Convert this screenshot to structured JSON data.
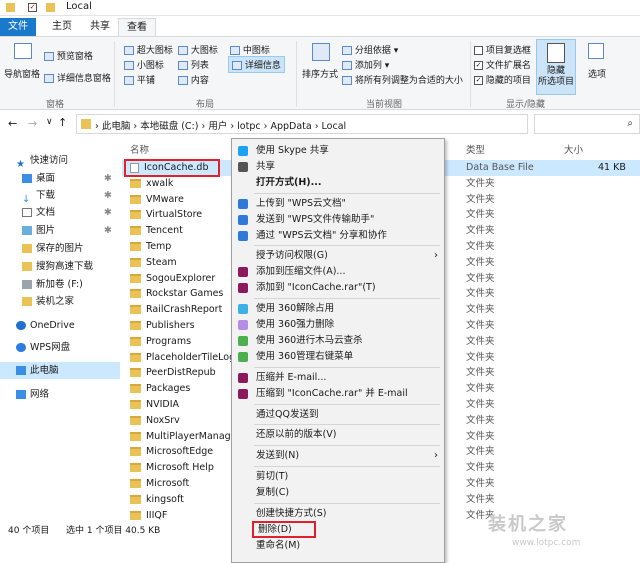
{
  "window": {
    "title": "Local"
  },
  "ribbon_tabs": [
    "文件",
    "主页",
    "共享",
    "查看"
  ],
  "ribbon": {
    "nav_pane": "导航窗格",
    "preview_pane": "预览窗格",
    "details_pane": "详细信息窗格",
    "pane_group": "窗格",
    "layout": {
      "items": [
        "超大图标",
        "大图标",
        "中图标",
        "小图标",
        "列表",
        "详细信息",
        "平铺",
        "内容"
      ],
      "group": "布局"
    },
    "sort_by": "排序方式",
    "group_by": "分组依据",
    "add_column": "添加列",
    "fit_columns": "将所有列调整为合适的大小",
    "current_view_group": "当前视图",
    "item_checkboxes": "项目复选框",
    "file_ext": "文件扩展名",
    "hidden_items": "隐藏的项目",
    "hide_selected": "隐藏\n所选项目",
    "show_hide_group": "显示/隐藏",
    "options": "选项"
  },
  "address": {
    "crumbs": [
      "此电脑",
      "本地磁盘 (C:)",
      "用户",
      "lotpc",
      "AppData",
      "Local"
    ]
  },
  "sidebar": {
    "items": [
      "快速访问",
      "桌面",
      "下载",
      "文档",
      "图片",
      "保存的图片",
      "搜狗高速下载",
      "新加卷 (F:)",
      "装机之家",
      "OneDrive",
      "WPS网盘",
      "此电脑",
      "网络"
    ]
  },
  "columns": {
    "name": "名称",
    "type": "类型",
    "size": "大小"
  },
  "files": [
    {
      "name": "IconCache.db",
      "type": "Data Base File",
      "size": "41 KB"
    },
    {
      "name": "xwalk",
      "type": "文件夹",
      "size": ""
    },
    {
      "name": "VMware",
      "type": "文件夹",
      "size": ""
    },
    {
      "name": "VirtualStore",
      "type": "文件夹",
      "size": ""
    },
    {
      "name": "Tencent",
      "type": "文件夹",
      "size": ""
    },
    {
      "name": "Temp",
      "type": "文件夹",
      "size": ""
    },
    {
      "name": "Steam",
      "type": "文件夹",
      "size": ""
    },
    {
      "name": "SogouExplorer",
      "type": "文件夹",
      "size": ""
    },
    {
      "name": "Rockstar Games",
      "type": "文件夹",
      "size": ""
    },
    {
      "name": "RailCrashReport",
      "type": "文件夹",
      "size": ""
    },
    {
      "name": "Publishers",
      "type": "文件夹",
      "size": ""
    },
    {
      "name": "Programs",
      "type": "文件夹",
      "size": ""
    },
    {
      "name": "PlaceholderTileLogo",
      "type": "文件夹",
      "size": ""
    },
    {
      "name": "PeerDistRepub",
      "type": "文件夹",
      "size": ""
    },
    {
      "name": "Packages",
      "type": "文件夹",
      "size": ""
    },
    {
      "name": "NVIDIA",
      "type": "文件夹",
      "size": ""
    },
    {
      "name": "NoxSrv",
      "type": "文件夹",
      "size": ""
    },
    {
      "name": "MultiPlayerManager",
      "type": "文件夹",
      "size": ""
    },
    {
      "name": "MicrosoftEdge",
      "type": "文件夹",
      "size": ""
    },
    {
      "name": "Microsoft Help",
      "type": "文件夹",
      "size": ""
    },
    {
      "name": "Microsoft",
      "type": "文件夹",
      "size": ""
    },
    {
      "name": "kingsoft",
      "type": "文件夹",
      "size": ""
    },
    {
      "name": "IIIQF",
      "type": "文件夹",
      "size": ""
    }
  ],
  "status": {
    "count": "40 个项目",
    "selected": "选中 1 个项目 40.5 KB"
  },
  "context_menu": [
    {
      "label": "使用 Skype 共享",
      "icon": "skype-icon",
      "color": "#1da1f2"
    },
    {
      "label": "共享",
      "icon": "share-icon",
      "color": "#555555"
    },
    {
      "label": "打开方式(H)...",
      "bold": true
    },
    {
      "sep": true
    },
    {
      "label": "上传到 \"WPS云文档\"",
      "icon": "upload-icon",
      "color": "#2f7ad9"
    },
    {
      "label": "发送到 \"WPS文件传输助手\"",
      "icon": "send-icon",
      "color": "#2f7ad9"
    },
    {
      "label": "通过 \"WPS云文档\" 分享和协作",
      "icon": "share-collab-icon",
      "color": "#2f7ad9"
    },
    {
      "sep": true
    },
    {
      "label": "授予访问权限(G)",
      "submenu": true
    },
    {
      "label": "添加到压缩文件(A)...",
      "icon": "winrar-icon",
      "color": "#8b1a5c"
    },
    {
      "label": "添加到 \"IconCache.rar\"(T)",
      "icon": "winrar-icon",
      "color": "#8b1a5c"
    },
    {
      "sep": true
    },
    {
      "label": "使用 360解除占用",
      "icon": "360-icon",
      "color": "#3db0e8"
    },
    {
      "label": "使用 360强力删除",
      "icon": "360-icon",
      "color": "#b58de6"
    },
    {
      "label": "使用 360进行木马云查杀",
      "icon": "360-icon",
      "color": "#4caf50"
    },
    {
      "label": "使用 360管理右键菜单",
      "icon": "360-icon",
      "color": "#4caf50"
    },
    {
      "sep": true
    },
    {
      "label": "压缩并 E-mail...",
      "icon": "winrar-icon",
      "color": "#8b1a5c"
    },
    {
      "label": "压缩到 \"IconCache.rar\" 并 E-mail",
      "icon": "winrar-icon",
      "color": "#8b1a5c"
    },
    {
      "sep": true
    },
    {
      "label": "通过QQ发送到"
    },
    {
      "sep": true
    },
    {
      "label": "还原以前的版本(V)"
    },
    {
      "sep": true
    },
    {
      "label": "发送到(N)",
      "submenu": true
    },
    {
      "sep": true
    },
    {
      "label": "剪切(T)"
    },
    {
      "label": "复制(C)"
    },
    {
      "sep": true
    },
    {
      "label": "创建快捷方式(S)"
    },
    {
      "label": "删除(D)",
      "highlight": true
    },
    {
      "label": "重命名(M)"
    }
  ],
  "watermark": {
    "text": "装机之家",
    "url": "www.lotpc.com"
  }
}
